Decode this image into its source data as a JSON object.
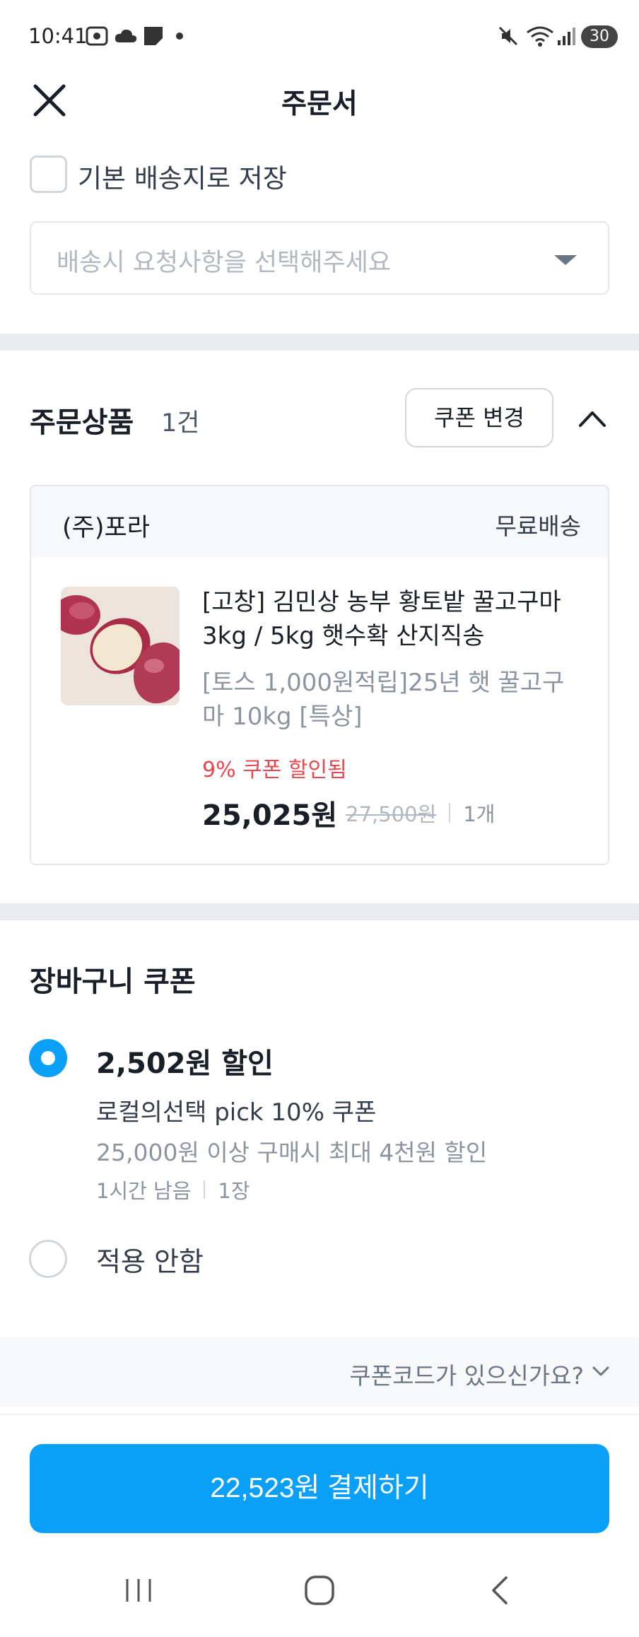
{
  "status_bar": {
    "time": "10:41",
    "battery": "30"
  },
  "header": {
    "title": "주문서"
  },
  "address": {
    "save_default_label": "기본 배송지로 저장",
    "request_placeholder": "배송시 요청사항을 선택해주세요"
  },
  "order_products": {
    "title": "주문상품",
    "count": "1건",
    "coupon_change_label": "쿠폰 변경",
    "seller": "(주)포라",
    "shipping": "무료배송",
    "product_name": "[고창] 김민상 농부 황토밭 꿀고구마 3kg / 5kg 햇수확 산지직송",
    "product_option": "[토스 1,000원적립]25년 햇 꿀고구마 10kg [특상]",
    "discount_note": "9% 쿠폰 할인됨",
    "price": "25,025원",
    "original_price": "27,500원",
    "quantity": "1개"
  },
  "cart_coupon": {
    "title": "장바구니 쿠폰",
    "selected_amount": "2,502원 할인",
    "selected_name": "로컬의선택 pick 10% 쿠폰",
    "selected_condition": "25,000원 이상 구매시 최대 4천원 할인",
    "selected_time_left": "1시간 남음",
    "selected_count": "1장",
    "none_label": "적용 안함",
    "code_prompt": "쿠폰코드가 있으신가요?"
  },
  "payment": {
    "button_label": "22,523원 결제하기"
  },
  "colors": {
    "accent": "#0aa0f7",
    "discount": "#e5484d"
  },
  "icons": [
    "screenshot-icon",
    "cloud-icon",
    "note-icon",
    "mute-icon",
    "wifi-icon",
    "signal-icon",
    "close-icon",
    "chevron-up-icon",
    "chevron-down-icon",
    "menu-icon",
    "home-icon",
    "back-icon"
  ]
}
